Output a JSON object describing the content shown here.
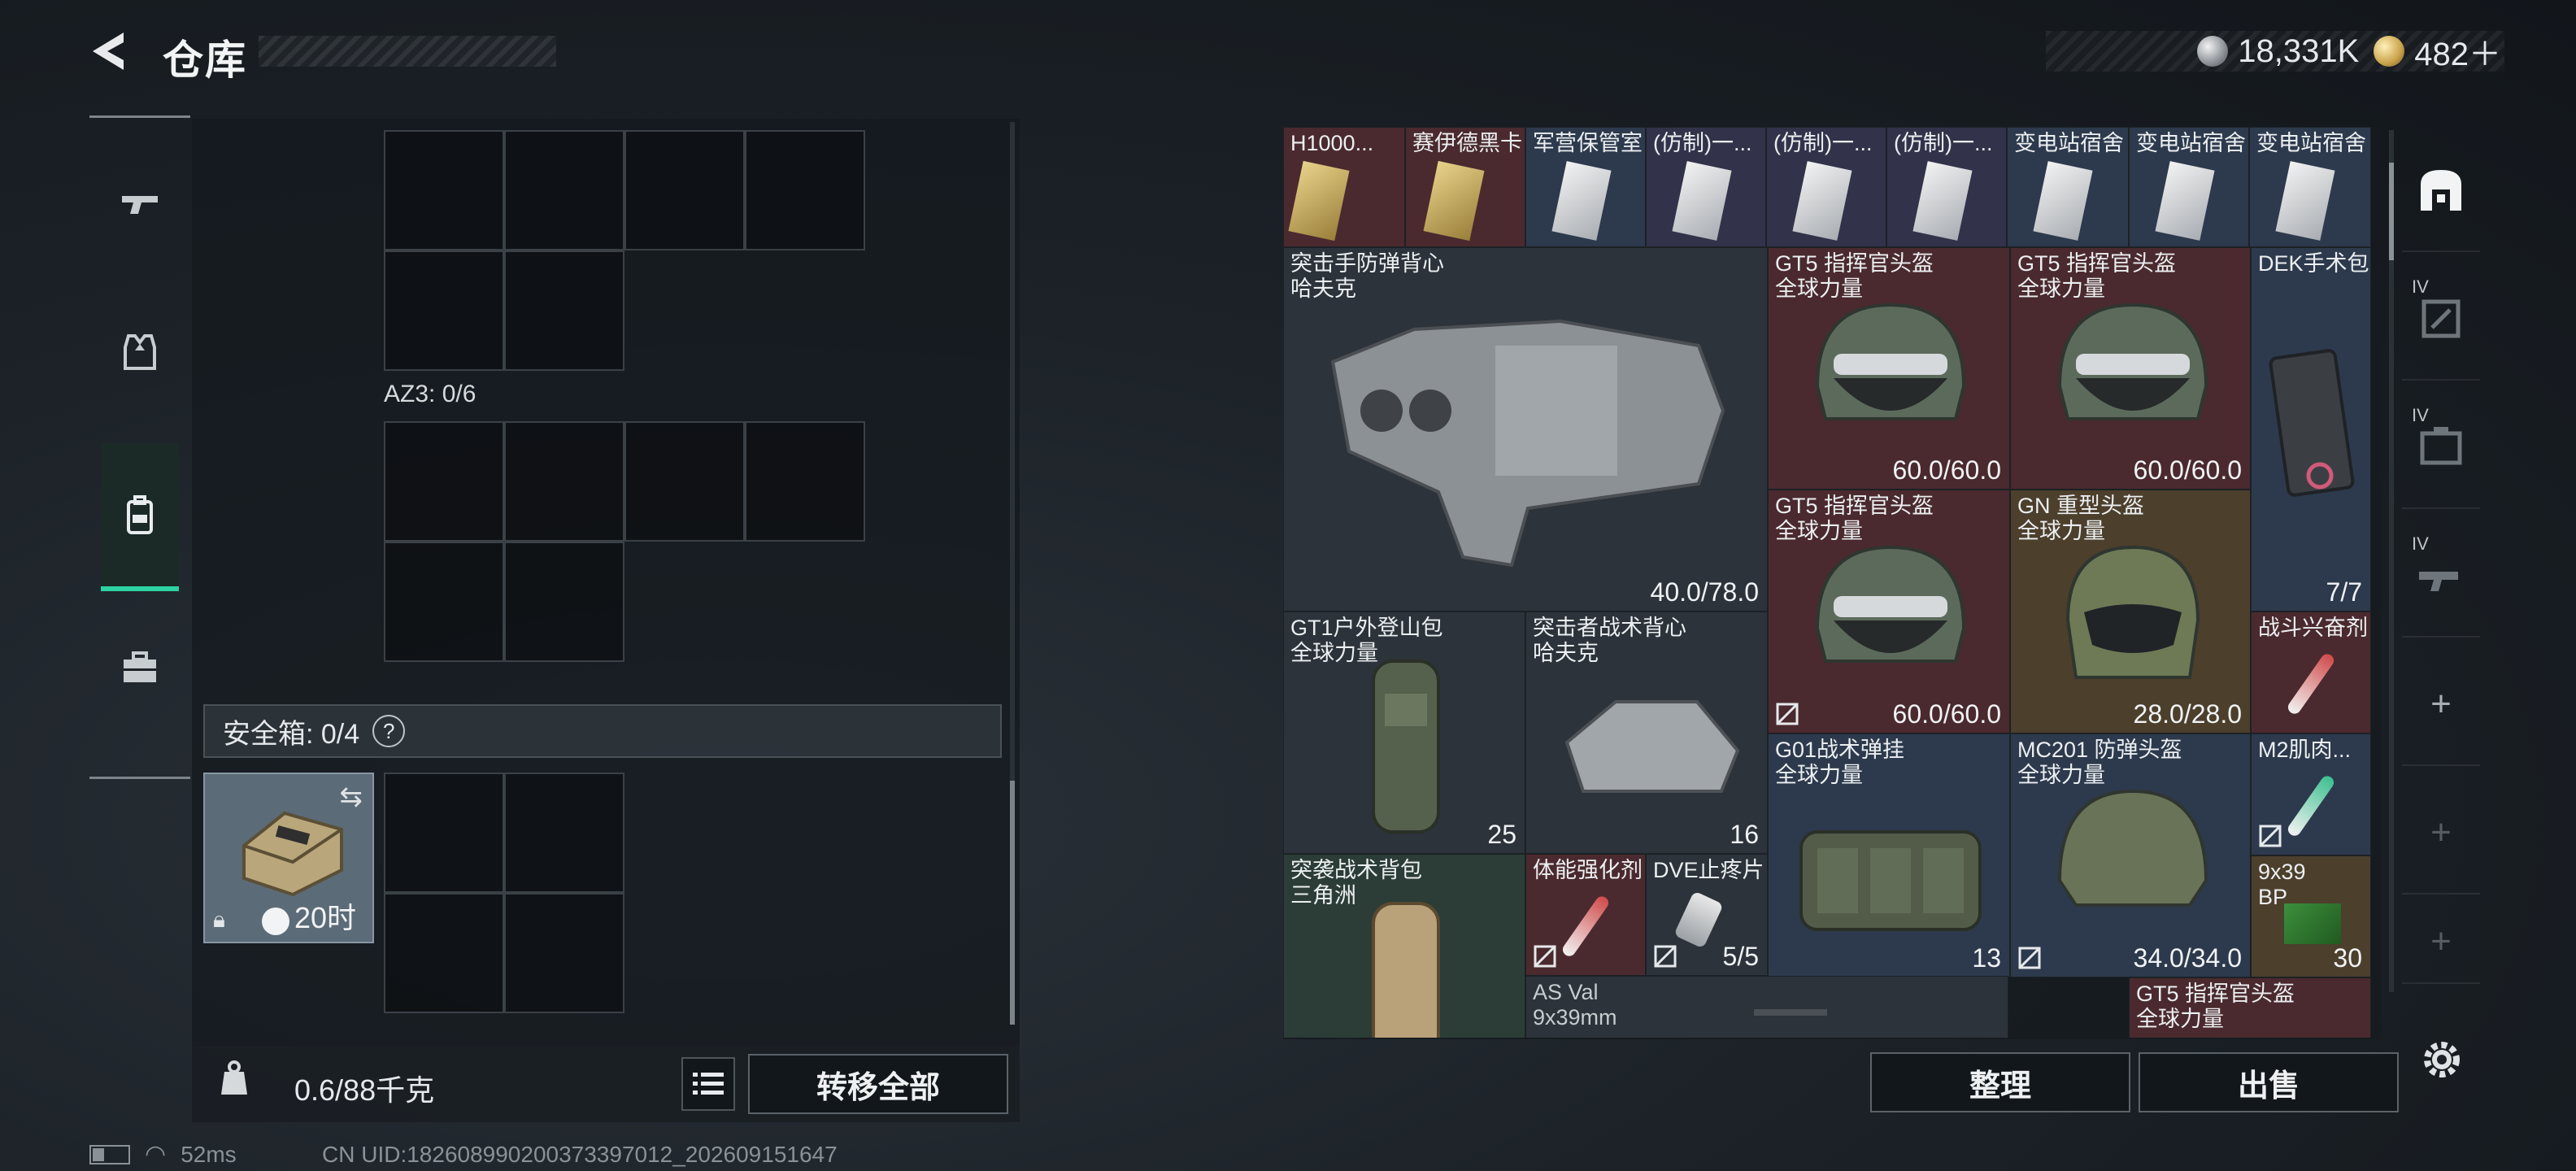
{
  "header": {
    "title": "仓库",
    "currency_silver": "18,331K",
    "currency_gold": "482＋"
  },
  "left_tabs": [
    "weapon-icon",
    "armor-icon",
    "backpack-icon",
    "toolbox-icon"
  ],
  "storage": {
    "az3_label": "AZ3: 0/6",
    "safe_label": "安全箱: 0/4",
    "safe_help": "?",
    "safebox_timer": "20时"
  },
  "bottom_left": {
    "weight": "0.6/88千克",
    "transfer_all": "转移全部"
  },
  "items": [
    {
      "name": "H1000...",
      "value": ""
    },
    {
      "name": "赛伊德黑卡",
      "value": ""
    },
    {
      "name": "军营保管室",
      "value": ""
    },
    {
      "name": "(仿制)一...",
      "value": ""
    },
    {
      "name": "(仿制)一...",
      "value": ""
    },
    {
      "name": "(仿制)一...",
      "value": ""
    },
    {
      "name": "变电站宿舍",
      "value": ""
    },
    {
      "name": "变电站宿舍",
      "value": ""
    },
    {
      "name": "变电站宿舍",
      "value": ""
    },
    {
      "name": "突击手防弹背心\n哈夫克",
      "value": "40.0/78.0"
    },
    {
      "name": "GT5 指挥官头盔\n全球力量",
      "value": "60.0/60.0"
    },
    {
      "name": "GT5 指挥官头盔\n全球力量",
      "value": "60.0/60.0"
    },
    {
      "name": "DEK手术包",
      "value": "7/7"
    },
    {
      "name": "GT5 指挥官头盔\n全球力量",
      "value": "60.0/60.0"
    },
    {
      "name": "GN 重型头盔\n全球力量",
      "value": "28.0/28.0"
    },
    {
      "name": "GT1户外登山包\n全球力量",
      "value": "25"
    },
    {
      "name": "突击者战术背心\n哈夫克",
      "value": "16"
    },
    {
      "name": "战斗兴奋剂",
      "value": ""
    },
    {
      "name": "G01战术弹挂\n全球力量",
      "value": "13"
    },
    {
      "name": "MC201 防弹头盔\n全球力量",
      "value": "34.0/34.0"
    },
    {
      "name": "M2肌肉...",
      "value": ""
    },
    {
      "name": "突袭战术背包\n三角洲",
      "value": ""
    },
    {
      "name": "体能强化剂",
      "value": ""
    },
    {
      "name": "DVE止疼片",
      "value": "5/5"
    },
    {
      "name": "9x39\nBP",
      "value": "30"
    },
    {
      "name": "AS Val\n9x39mm",
      "value": ""
    },
    {
      "name": "GT5 指挥官头盔\n全球力量",
      "value": ""
    }
  ],
  "right_tabs": [
    "safehouse-icon",
    "level-iv-1",
    "level-iv-2",
    "level-iv-3",
    "add-1",
    "add-2",
    "add-3"
  ],
  "right_tab_level": "IV",
  "right_tab_add": "+",
  "actions": {
    "sort": "整理",
    "sell": "出售"
  },
  "status": {
    "ping": "52ms",
    "uid": "CN UID:1826089902003733970​12_202609151647"
  }
}
